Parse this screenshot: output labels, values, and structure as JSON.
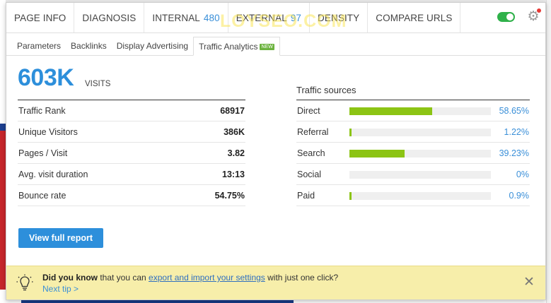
{
  "topnav": {
    "tabs": [
      {
        "label": "PAGE INFO"
      },
      {
        "label": "DIAGNOSIS"
      },
      {
        "label": "INTERNAL",
        "count": "480"
      },
      {
        "label": "EXTERNAL",
        "count": "97"
      },
      {
        "label": "DENSITY"
      },
      {
        "label": "COMPARE URLS"
      }
    ],
    "watermark": "LOYSEO.COM"
  },
  "subtabs": [
    {
      "label": "Parameters"
    },
    {
      "label": "Backlinks"
    },
    {
      "label": "Display Advertising"
    },
    {
      "label": "Traffic Analytics",
      "badge": "new"
    }
  ],
  "visits": {
    "value": "603K",
    "label": "VISITS"
  },
  "stats": [
    {
      "label": "Traffic Rank",
      "value": "68917"
    },
    {
      "label": "Unique Visitors",
      "value": "386K"
    },
    {
      "label": "Pages / Visit",
      "value": "3.82"
    },
    {
      "label": "Avg. visit duration",
      "value": "13:13"
    },
    {
      "label": "Bounce rate",
      "value": "54.75%"
    }
  ],
  "report_button": "View full report",
  "sources": {
    "title": "Traffic sources",
    "items": [
      {
        "label": "Direct",
        "pct_text": "58.65%",
        "pct": 58.65
      },
      {
        "label": "Referral",
        "pct_text": "1.22%",
        "pct": 1.22
      },
      {
        "label": "Search",
        "pct_text": "39.23%",
        "pct": 39.23
      },
      {
        "label": "Social",
        "pct_text": "0%",
        "pct": 0
      },
      {
        "label": "Paid",
        "pct_text": "0.9%",
        "pct": 0.9
      }
    ]
  },
  "tip": {
    "lead": "Did you know",
    "text_before": " that you can ",
    "link": "export and import your settings",
    "text_after": " with just one click?",
    "next": "Next tip >"
  },
  "colors": {
    "accent": "#2d8fdb",
    "bar_fill": "#8cc414",
    "toggle_on": "#2fb14a",
    "tip_bg": "#f7eeaa"
  },
  "icons": {
    "settings": "gear-icon",
    "tip": "lightbulb-icon",
    "close": "close-icon"
  }
}
